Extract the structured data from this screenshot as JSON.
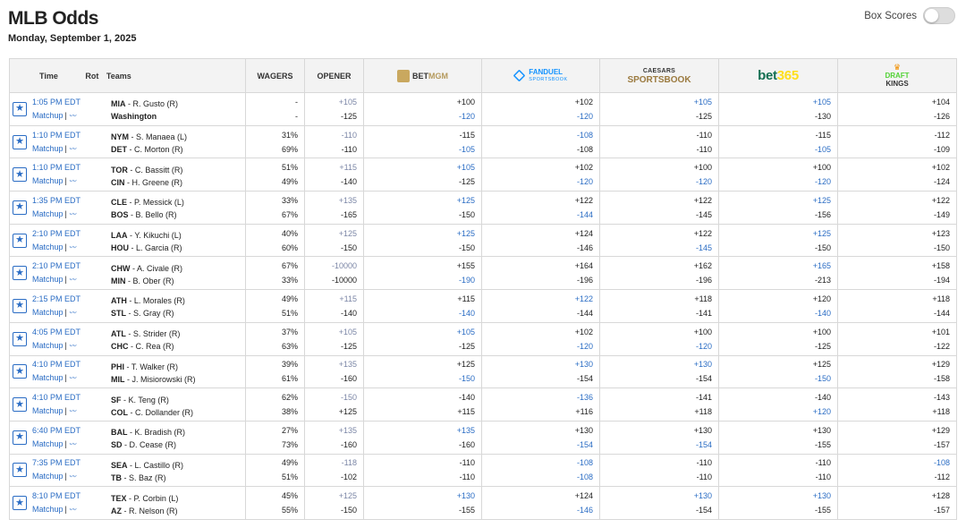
{
  "header": {
    "title": "MLB Odds",
    "date": "Monday, September 1, 2025",
    "box_scores_label": "Box Scores"
  },
  "columns": {
    "time": "Time",
    "rot": "Rot",
    "teams": "Teams",
    "wagers": "WAGERS",
    "opener": "OPENER"
  },
  "sportsbooks": [
    {
      "name": "BETMGM",
      "logo_text": [
        "BET",
        "MGM"
      ]
    },
    {
      "name": "FANDUEL SPORTSBOOK",
      "logo_text": [
        "FANDUEL",
        "SPORTSBOOK"
      ]
    },
    {
      "name": "CAESARS SPORTSBOOK",
      "logo_text": [
        "CAESARS",
        "SPORTSBOOK"
      ]
    },
    {
      "name": "bet365",
      "logo_text": [
        "bet",
        "365"
      ]
    },
    {
      "name": "DRAFTKINGS",
      "logo_text": [
        "DRAFT",
        "KINGS"
      ]
    }
  ],
  "matchup_label": "Matchup",
  "colors": {
    "link_blue": "#2a6cc4",
    "opener_grey": "#7b86a6"
  },
  "games": [
    {
      "time": "1:05 PM EDT",
      "away": {
        "abbr": "MIA",
        "pitcher": "R. Gusto (R)"
      },
      "home": {
        "abbr": "Washington",
        "pitcher": ""
      },
      "wagers": [
        "-",
        "-"
      ],
      "opener": [
        {
          "v": "+105",
          "c": "grey"
        },
        {
          "v": "-125",
          "c": ""
        }
      ],
      "books": [
        [
          {
            "v": "+100",
            "c": ""
          },
          {
            "v": "-120",
            "c": "blue"
          }
        ],
        [
          {
            "v": "+102",
            "c": ""
          },
          {
            "v": "-120",
            "c": "blue"
          }
        ],
        [
          {
            "v": "+105",
            "c": "blue"
          },
          {
            "v": "-125",
            "c": ""
          }
        ],
        [
          {
            "v": "+105",
            "c": "blue"
          },
          {
            "v": "-130",
            "c": ""
          }
        ],
        [
          {
            "v": "+104",
            "c": ""
          },
          {
            "v": "-126",
            "c": ""
          }
        ]
      ]
    },
    {
      "time": "1:10 PM EDT",
      "away": {
        "abbr": "NYM",
        "pitcher": "S. Manaea (L)"
      },
      "home": {
        "abbr": "DET",
        "pitcher": "C. Morton (R)"
      },
      "wagers": [
        "31%",
        "69%"
      ],
      "opener": [
        {
          "v": "-110",
          "c": "grey"
        },
        {
          "v": "-110",
          "c": ""
        }
      ],
      "books": [
        [
          {
            "v": "-115",
            "c": ""
          },
          {
            "v": "-105",
            "c": "blue"
          }
        ],
        [
          {
            "v": "-108",
            "c": "blue"
          },
          {
            "v": "-108",
            "c": ""
          }
        ],
        [
          {
            "v": "-110",
            "c": ""
          },
          {
            "v": "-110",
            "c": ""
          }
        ],
        [
          {
            "v": "-115",
            "c": ""
          },
          {
            "v": "-105",
            "c": "blue"
          }
        ],
        [
          {
            "v": "-112",
            "c": ""
          },
          {
            "v": "-109",
            "c": ""
          }
        ]
      ]
    },
    {
      "time": "1:10 PM EDT",
      "away": {
        "abbr": "TOR",
        "pitcher": "C. Bassitt (R)"
      },
      "home": {
        "abbr": "CIN",
        "pitcher": "H. Greene (R)"
      },
      "wagers": [
        "51%",
        "49%"
      ],
      "opener": [
        {
          "v": "+115",
          "c": "grey"
        },
        {
          "v": "-140",
          "c": ""
        }
      ],
      "books": [
        [
          {
            "v": "+105",
            "c": "blue"
          },
          {
            "v": "-125",
            "c": ""
          }
        ],
        [
          {
            "v": "+102",
            "c": ""
          },
          {
            "v": "-120",
            "c": "blue"
          }
        ],
        [
          {
            "v": "+100",
            "c": ""
          },
          {
            "v": "-120",
            "c": "blue"
          }
        ],
        [
          {
            "v": "+100",
            "c": ""
          },
          {
            "v": "-120",
            "c": "blue"
          }
        ],
        [
          {
            "v": "+102",
            "c": ""
          },
          {
            "v": "-124",
            "c": ""
          }
        ]
      ]
    },
    {
      "time": "1:35 PM EDT",
      "away": {
        "abbr": "CLE",
        "pitcher": "P. Messick (L)"
      },
      "home": {
        "abbr": "BOS",
        "pitcher": "B. Bello (R)"
      },
      "wagers": [
        "33%",
        "67%"
      ],
      "opener": [
        {
          "v": "+135",
          "c": "grey"
        },
        {
          "v": "-165",
          "c": ""
        }
      ],
      "books": [
        [
          {
            "v": "+125",
            "c": "blue"
          },
          {
            "v": "-150",
            "c": ""
          }
        ],
        [
          {
            "v": "+122",
            "c": ""
          },
          {
            "v": "-144",
            "c": "blue"
          }
        ],
        [
          {
            "v": "+122",
            "c": ""
          },
          {
            "v": "-145",
            "c": ""
          }
        ],
        [
          {
            "v": "+125",
            "c": "blue"
          },
          {
            "v": "-156",
            "c": ""
          }
        ],
        [
          {
            "v": "+122",
            "c": ""
          },
          {
            "v": "-149",
            "c": ""
          }
        ]
      ]
    },
    {
      "time": "2:10 PM EDT",
      "away": {
        "abbr": "LAA",
        "pitcher": "Y. Kikuchi (L)"
      },
      "home": {
        "abbr": "HOU",
        "pitcher": "L. Garcia (R)"
      },
      "wagers": [
        "40%",
        "60%"
      ],
      "opener": [
        {
          "v": "+125",
          "c": "grey"
        },
        {
          "v": "-150",
          "c": ""
        }
      ],
      "books": [
        [
          {
            "v": "+125",
            "c": "blue"
          },
          {
            "v": "-150",
            "c": ""
          }
        ],
        [
          {
            "v": "+124",
            "c": ""
          },
          {
            "v": "-146",
            "c": ""
          }
        ],
        [
          {
            "v": "+122",
            "c": ""
          },
          {
            "v": "-145",
            "c": "blue"
          }
        ],
        [
          {
            "v": "+125",
            "c": "blue"
          },
          {
            "v": "-150",
            "c": ""
          }
        ],
        [
          {
            "v": "+123",
            "c": ""
          },
          {
            "v": "-150",
            "c": ""
          }
        ]
      ]
    },
    {
      "time": "2:10 PM EDT",
      "away": {
        "abbr": "CHW",
        "pitcher": "A. Civale (R)"
      },
      "home": {
        "abbr": "MIN",
        "pitcher": "B. Ober (R)"
      },
      "wagers": [
        "67%",
        "33%"
      ],
      "opener": [
        {
          "v": "-10000",
          "c": "grey"
        },
        {
          "v": "-10000",
          "c": ""
        }
      ],
      "books": [
        [
          {
            "v": "+155",
            "c": ""
          },
          {
            "v": "-190",
            "c": "blue"
          }
        ],
        [
          {
            "v": "+164",
            "c": ""
          },
          {
            "v": "-196",
            "c": ""
          }
        ],
        [
          {
            "v": "+162",
            "c": ""
          },
          {
            "v": "-196",
            "c": ""
          }
        ],
        [
          {
            "v": "+165",
            "c": "blue"
          },
          {
            "v": "-213",
            "c": ""
          }
        ],
        [
          {
            "v": "+158",
            "c": ""
          },
          {
            "v": "-194",
            "c": ""
          }
        ]
      ]
    },
    {
      "time": "2:15 PM EDT",
      "away": {
        "abbr": "ATH",
        "pitcher": "L. Morales (R)"
      },
      "home": {
        "abbr": "STL",
        "pitcher": "S. Gray (R)"
      },
      "wagers": [
        "49%",
        "51%"
      ],
      "opener": [
        {
          "v": "+115",
          "c": "grey"
        },
        {
          "v": "-140",
          "c": ""
        }
      ],
      "books": [
        [
          {
            "v": "+115",
            "c": ""
          },
          {
            "v": "-140",
            "c": "blue"
          }
        ],
        [
          {
            "v": "+122",
            "c": "blue"
          },
          {
            "v": "-144",
            "c": ""
          }
        ],
        [
          {
            "v": "+118",
            "c": ""
          },
          {
            "v": "-141",
            "c": ""
          }
        ],
        [
          {
            "v": "+120",
            "c": ""
          },
          {
            "v": "-140",
            "c": "blue"
          }
        ],
        [
          {
            "v": "+118",
            "c": ""
          },
          {
            "v": "-144",
            "c": ""
          }
        ]
      ]
    },
    {
      "time": "4:05 PM EDT",
      "away": {
        "abbr": "ATL",
        "pitcher": "S. Strider (R)"
      },
      "home": {
        "abbr": "CHC",
        "pitcher": "C. Rea (R)"
      },
      "wagers": [
        "37%",
        "63%"
      ],
      "opener": [
        {
          "v": "+105",
          "c": "grey"
        },
        {
          "v": "-125",
          "c": ""
        }
      ],
      "books": [
        [
          {
            "v": "+105",
            "c": "blue"
          },
          {
            "v": "-125",
            "c": ""
          }
        ],
        [
          {
            "v": "+102",
            "c": ""
          },
          {
            "v": "-120",
            "c": "blue"
          }
        ],
        [
          {
            "v": "+100",
            "c": ""
          },
          {
            "v": "-120",
            "c": "blue"
          }
        ],
        [
          {
            "v": "+100",
            "c": ""
          },
          {
            "v": "-125",
            "c": ""
          }
        ],
        [
          {
            "v": "+101",
            "c": ""
          },
          {
            "v": "-122",
            "c": ""
          }
        ]
      ]
    },
    {
      "time": "4:10 PM EDT",
      "away": {
        "abbr": "PHI",
        "pitcher": "T. Walker (R)"
      },
      "home": {
        "abbr": "MIL",
        "pitcher": "J. Misiorowski (R)"
      },
      "wagers": [
        "39%",
        "61%"
      ],
      "opener": [
        {
          "v": "+135",
          "c": "grey"
        },
        {
          "v": "-160",
          "c": ""
        }
      ],
      "books": [
        [
          {
            "v": "+125",
            "c": ""
          },
          {
            "v": "-150",
            "c": "blue"
          }
        ],
        [
          {
            "v": "+130",
            "c": "blue"
          },
          {
            "v": "-154",
            "c": ""
          }
        ],
        [
          {
            "v": "+130",
            "c": "blue"
          },
          {
            "v": "-154",
            "c": ""
          }
        ],
        [
          {
            "v": "+125",
            "c": ""
          },
          {
            "v": "-150",
            "c": "blue"
          }
        ],
        [
          {
            "v": "+129",
            "c": ""
          },
          {
            "v": "-158",
            "c": ""
          }
        ]
      ]
    },
    {
      "time": "4:10 PM EDT",
      "away": {
        "abbr": "SF",
        "pitcher": "K. Teng (R)"
      },
      "home": {
        "abbr": "COL",
        "pitcher": "C. Dollander (R)"
      },
      "wagers": [
        "62%",
        "38%"
      ],
      "opener": [
        {
          "v": "-150",
          "c": "grey"
        },
        {
          "v": "+125",
          "c": ""
        }
      ],
      "books": [
        [
          {
            "v": "-140",
            "c": ""
          },
          {
            "v": "+115",
            "c": ""
          }
        ],
        [
          {
            "v": "-136",
            "c": "blue"
          },
          {
            "v": "+116",
            "c": ""
          }
        ],
        [
          {
            "v": "-141",
            "c": ""
          },
          {
            "v": "+118",
            "c": ""
          }
        ],
        [
          {
            "v": "-140",
            "c": ""
          },
          {
            "v": "+120",
            "c": "blue"
          }
        ],
        [
          {
            "v": "-143",
            "c": ""
          },
          {
            "v": "+118",
            "c": ""
          }
        ]
      ]
    },
    {
      "time": "6:40 PM EDT",
      "away": {
        "abbr": "BAL",
        "pitcher": "K. Bradish (R)"
      },
      "home": {
        "abbr": "SD",
        "pitcher": "D. Cease (R)"
      },
      "wagers": [
        "27%",
        "73%"
      ],
      "opener": [
        {
          "v": "+135",
          "c": "grey"
        },
        {
          "v": "-160",
          "c": ""
        }
      ],
      "books": [
        [
          {
            "v": "+135",
            "c": "blue"
          },
          {
            "v": "-160",
            "c": ""
          }
        ],
        [
          {
            "v": "+130",
            "c": ""
          },
          {
            "v": "-154",
            "c": "blue"
          }
        ],
        [
          {
            "v": "+130",
            "c": ""
          },
          {
            "v": "-154",
            "c": "blue"
          }
        ],
        [
          {
            "v": "+130",
            "c": ""
          },
          {
            "v": "-155",
            "c": ""
          }
        ],
        [
          {
            "v": "+129",
            "c": ""
          },
          {
            "v": "-157",
            "c": ""
          }
        ]
      ]
    },
    {
      "time": "7:35 PM EDT",
      "away": {
        "abbr": "SEA",
        "pitcher": "L. Castillo (R)"
      },
      "home": {
        "abbr": "TB",
        "pitcher": "S. Baz (R)"
      },
      "wagers": [
        "49%",
        "51%"
      ],
      "opener": [
        {
          "v": "-118",
          "c": "grey"
        },
        {
          "v": "-102",
          "c": ""
        }
      ],
      "books": [
        [
          {
            "v": "-110",
            "c": ""
          },
          {
            "v": "-110",
            "c": ""
          }
        ],
        [
          {
            "v": "-108",
            "c": "blue"
          },
          {
            "v": "-108",
            "c": "blue"
          }
        ],
        [
          {
            "v": "-110",
            "c": ""
          },
          {
            "v": "-110",
            "c": ""
          }
        ],
        [
          {
            "v": "-110",
            "c": ""
          },
          {
            "v": "-110",
            "c": ""
          }
        ],
        [
          {
            "v": "-108",
            "c": "blue"
          },
          {
            "v": "-112",
            "c": ""
          }
        ]
      ]
    },
    {
      "time": "8:10 PM EDT",
      "away": {
        "abbr": "TEX",
        "pitcher": "P. Corbin (L)"
      },
      "home": {
        "abbr": "AZ",
        "pitcher": "R. Nelson (R)"
      },
      "wagers": [
        "45%",
        "55%"
      ],
      "opener": [
        {
          "v": "+125",
          "c": "grey"
        },
        {
          "v": "-150",
          "c": ""
        }
      ],
      "books": [
        [
          {
            "v": "+130",
            "c": "blue"
          },
          {
            "v": "-155",
            "c": ""
          }
        ],
        [
          {
            "v": "+124",
            "c": ""
          },
          {
            "v": "-146",
            "c": "blue"
          }
        ],
        [
          {
            "v": "+130",
            "c": "blue"
          },
          {
            "v": "-154",
            "c": ""
          }
        ],
        [
          {
            "v": "+130",
            "c": "blue"
          },
          {
            "v": "-155",
            "c": ""
          }
        ],
        [
          {
            "v": "+128",
            "c": ""
          },
          {
            "v": "-157",
            "c": ""
          }
        ]
      ]
    }
  ]
}
